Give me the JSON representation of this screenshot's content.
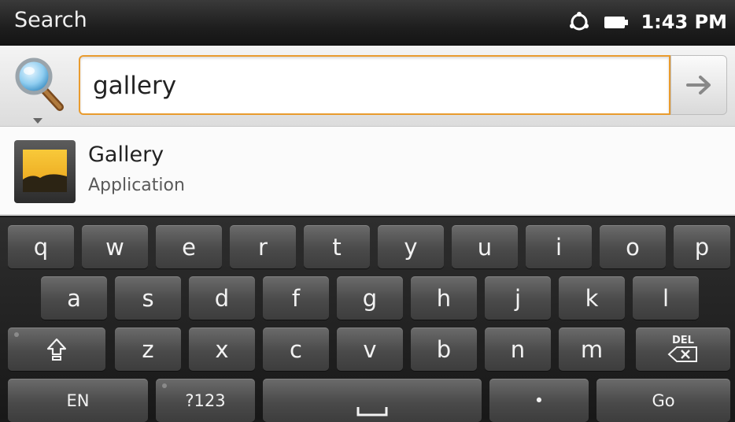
{
  "status_bar": {
    "title": "Search",
    "time": "1:43 PM",
    "icons": [
      "sync-icon",
      "battery-icon"
    ]
  },
  "search": {
    "engine_icon": "magnifier-icon",
    "query": "gallery",
    "go_icon": "arrow-right-icon",
    "accent_color": "#e99b2e"
  },
  "suggestion": {
    "title": "Gallery",
    "subtitle": "Application",
    "icon": "gallery-app-icon"
  },
  "keyboard": {
    "row1": [
      "q",
      "w",
      "e",
      "r",
      "t",
      "y",
      "u",
      "i",
      "o",
      "p"
    ],
    "row2": [
      "a",
      "s",
      "d",
      "f",
      "g",
      "h",
      "j",
      "k",
      "l"
    ],
    "row3": [
      "z",
      "x",
      "c",
      "v",
      "b",
      "n",
      "m"
    ],
    "del_label": "DEL",
    "lang_label": "EN",
    "symbols_label": "?123",
    "period_label": "•",
    "go_label": "Go"
  }
}
